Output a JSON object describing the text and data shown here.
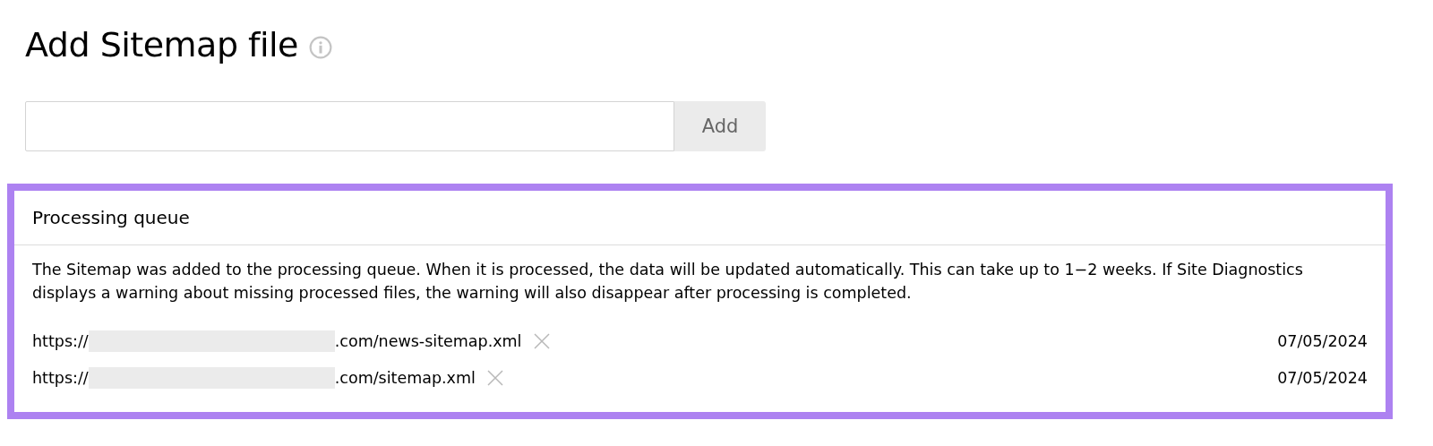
{
  "title": "Add Sitemap file",
  "form": {
    "button": "Add"
  },
  "queue": {
    "heading": "Processing queue",
    "message": "The Sitemap was added to the processing queue. When it is processed, the data will be updated automatically. This can take up to 1−2 weeks. If Site Diagnostics displays a warning about missing processed files, the warning will also disappear after processing is completed.",
    "items": [
      {
        "prefix": "https://",
        "suffix": ".com/news-sitemap.xml",
        "date": "07/05/2024"
      },
      {
        "prefix": "https://",
        "suffix": ".com/sitemap.xml",
        "date": "07/05/2024"
      }
    ]
  }
}
